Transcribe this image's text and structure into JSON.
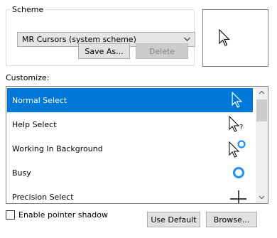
{
  "scheme": {
    "group_label": "Scheme",
    "selected": "MR Cursors (system scheme)",
    "save_as_label": "Save As...",
    "delete_label": "Delete"
  },
  "customize": {
    "label": "Customize:",
    "items": [
      {
        "label": "Normal Select",
        "icon": "arrow-cursor-icon",
        "selected": true
      },
      {
        "label": "Help Select",
        "icon": "help-cursor-icon",
        "selected": false
      },
      {
        "label": "Working In Background",
        "icon": "working-cursor-icon",
        "selected": false
      },
      {
        "label": "Busy",
        "icon": "busy-cursor-icon",
        "selected": false
      },
      {
        "label": "Precision Select",
        "icon": "crosshair-cursor-icon",
        "selected": false
      }
    ]
  },
  "footer": {
    "shadow_label": "Enable pointer shadow",
    "shadow_checked": false,
    "use_default_label": "Use Default",
    "browse_label": "Browse..."
  },
  "colors": {
    "selection": "#0078d7",
    "busy_ring": "#1e90ff"
  }
}
